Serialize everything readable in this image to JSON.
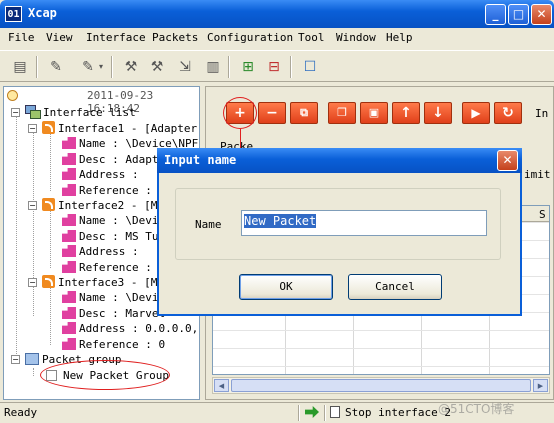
{
  "window": {
    "icon_text": "01",
    "title": "Xcap",
    "minimize": "_",
    "maximize": "□",
    "close": "✕"
  },
  "menu": [
    "File",
    "View",
    "Interface",
    "Packets",
    "Configuration",
    "Tool",
    "Window",
    "Help"
  ],
  "toolbar_icons": [
    "interface-card-icon",
    "open-icon",
    "open-dropdown-icon",
    "capture-start-icon",
    "capture-stop-icon",
    "export-icon",
    "book-icon",
    "add-packet-icon",
    "remove-packet-icon",
    "chat-icon"
  ],
  "tree": {
    "timestamp": "2011-09-23 16:18:42",
    "root_label": "Interface list",
    "interfaces": [
      {
        "label": "Interface1 - [Adapter f",
        "props": [
          "Name : \\Device\\NPF_G",
          "Desc : Adapte",
          "Address :",
          "Reference : 0"
        ]
      },
      {
        "label": "Interface2 - [MS",
        "props": [
          "Name : \\Devic",
          "Desc : MS Tun",
          "Address :",
          "Reference : 0"
        ]
      },
      {
        "label": "Interface3 - [Ma",
        "props": [
          "Name : \\Devic",
          "Desc : Marvel",
          "Address : 0.0.0.0,18",
          "Reference : 0"
        ]
      }
    ],
    "packet_group_label": "Packet group",
    "new_packet_group": "New Packet Group"
  },
  "right": {
    "buttons": [
      "+",
      "−",
      "⧉",
      "❐",
      "▣",
      "↑",
      "↓",
      "▶",
      "↻"
    ],
    "side_label": "In",
    "bg_label_1": "Packe",
    "bg_label_2": "imit",
    "bg_label_3": "S"
  },
  "dialog": {
    "title": "Input name",
    "close": "✕",
    "name_label": "Name",
    "name_value": "New Packet",
    "ok": "OK",
    "cancel": "Cancel"
  },
  "status": {
    "ready": "Ready",
    "message": "Stop interface 2"
  },
  "watermark": "@51CTO博客"
}
